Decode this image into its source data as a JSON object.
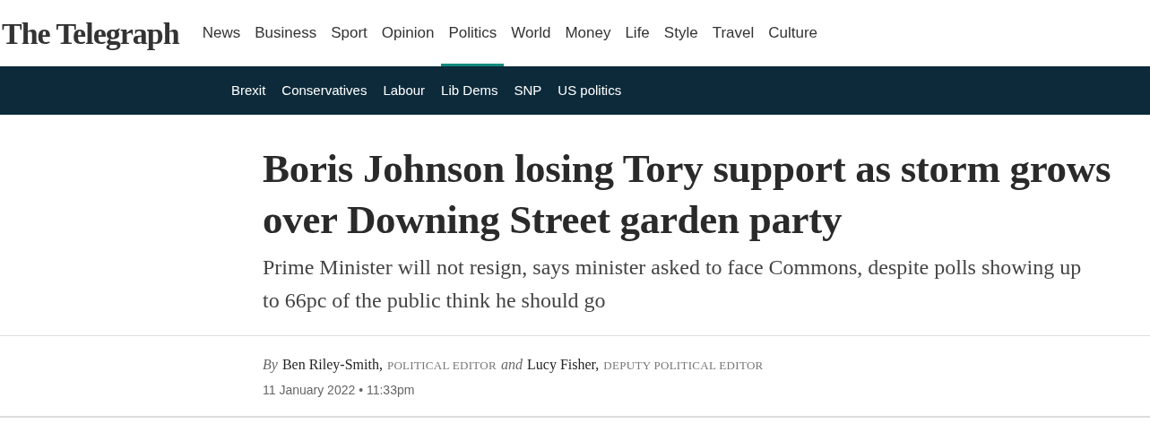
{
  "logo": "The Telegraph",
  "nav": [
    {
      "label": "News",
      "selected": false
    },
    {
      "label": "Business",
      "selected": false
    },
    {
      "label": "Sport",
      "selected": false
    },
    {
      "label": "Opinion",
      "selected": false
    },
    {
      "label": "Politics",
      "selected": true
    },
    {
      "label": "World",
      "selected": false
    },
    {
      "label": "Money",
      "selected": false
    },
    {
      "label": "Life",
      "selected": false
    },
    {
      "label": "Style",
      "selected": false
    },
    {
      "label": "Travel",
      "selected": false
    },
    {
      "label": "Culture",
      "selected": false
    }
  ],
  "subnav": [
    "Brexit",
    "Conservatives",
    "Labour",
    "Lib Dems",
    "SNP",
    "US politics"
  ],
  "headline": "Boris Johnson losing Tory support as storm grows over Downing Street garden party",
  "standfirst": "Prime Minister will not resign, says minister asked to face Commons, despite polls showing up to 66pc of the public think he should go",
  "byline": [
    {
      "kind": "conjunction",
      "text": "By"
    },
    {
      "kind": "name",
      "text": "Ben Riley-Smith,"
    },
    {
      "kind": "role",
      "text": "POLITICAL EDITOR"
    },
    {
      "kind": "conjunction",
      "text": "and"
    },
    {
      "kind": "name",
      "text": "Lucy Fisher,"
    },
    {
      "kind": "role",
      "text": "DEPUTY POLITICAL EDITOR"
    }
  ],
  "timestamp": "11 January 2022 • 11:33pm"
}
